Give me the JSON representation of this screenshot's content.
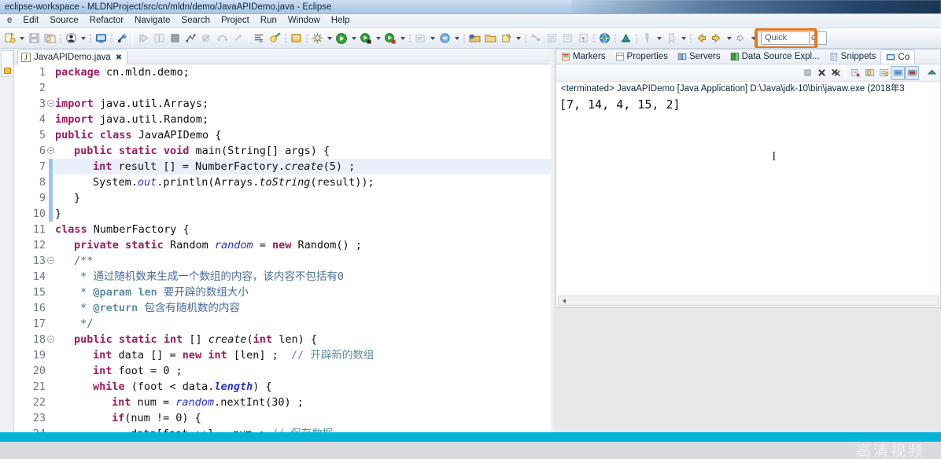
{
  "window": {
    "title": "eclipse-workspace - MLDNProject/src/cn/mldn/demo/JavaAPIDemo.java - Eclipse"
  },
  "menubar": {
    "items": [
      {
        "label": "e"
      },
      {
        "label": "Edit"
      },
      {
        "label": "Source"
      },
      {
        "label": "Refactor"
      },
      {
        "label": "Navigate"
      },
      {
        "label": "Search"
      },
      {
        "label": "Project"
      },
      {
        "label": "Run"
      },
      {
        "label": "Window"
      },
      {
        "label": "Help"
      }
    ]
  },
  "toolbar": {
    "quick_access_value": "Quick",
    "quick_access_overflow": "c",
    "highlight_color": "#e8761a",
    "icons": [
      "new-wizard-icon",
      "save-icon",
      "save-all-icon",
      "print-icon",
      "person-icon",
      "terminal-icon",
      "link-icon",
      "step-into-icon",
      "step-over-icon",
      "stop-icon",
      "relaunch-icon",
      "skip-breakpoints-icon",
      "disconnect-icon",
      "remove-terminated-icon",
      "coverage-icon",
      "task-icon",
      "note-icon",
      "build-icon",
      "run-icon",
      "debug-icon",
      "run-as-icon",
      "external-tools-icon",
      "open-type-icon",
      "search-icon",
      "open-resource-icon",
      "new-java-project-icon",
      "new-package-icon",
      "new-class-icon",
      "globe-icon",
      "profile-icon",
      "pin-icon",
      "back-icon",
      "forward-icon",
      "next-annotation-icon"
    ]
  },
  "editor": {
    "tab": {
      "label": "JavaAPIDemo.java",
      "icon": "java-file-icon",
      "close_glyph": "✖",
      "file_letter": "J"
    },
    "lines": [
      {
        "n": "1",
        "fold": false,
        "indent": 0,
        "text": "package cn.mldn.demo;"
      },
      {
        "n": "2",
        "fold": false,
        "indent": 0,
        "text": ""
      },
      {
        "n": "3",
        "fold": true,
        "indent": 0,
        "text": "import java.util.Arrays;"
      },
      {
        "n": "4",
        "fold": false,
        "indent": 0,
        "text": "import java.util.Random;"
      },
      {
        "n": "5",
        "fold": false,
        "indent": 0,
        "text": "public class JavaAPIDemo {"
      },
      {
        "n": "6",
        "fold": true,
        "indent": 1,
        "text": "public static void main(String[] args) {"
      },
      {
        "n": "7",
        "fold": false,
        "indent": 2,
        "text": "int result [] = NumberFactory.create(5) ;"
      },
      {
        "n": "8",
        "fold": false,
        "indent": 2,
        "text": "System.out.println(Arrays.toString(result));"
      },
      {
        "n": "9",
        "fold": false,
        "indent": 1,
        "text": "}"
      },
      {
        "n": "10",
        "fold": false,
        "indent": 0,
        "text": "}"
      },
      {
        "n": "11",
        "fold": false,
        "indent": 0,
        "text": "class NumberFactory {"
      },
      {
        "n": "12",
        "fold": false,
        "indent": 1,
        "text": "private static Random random = new Random() ;"
      },
      {
        "n": "13",
        "fold": true,
        "indent": 1,
        "text": "/**"
      },
      {
        "n": "14",
        "fold": false,
        "indent": 1,
        "text": " * 通过随机数来生成一个数组的内容，该内容不包括有0"
      },
      {
        "n": "15",
        "fold": false,
        "indent": 1,
        "text": " * @param len 要开辟的数组大小"
      },
      {
        "n": "16",
        "fold": false,
        "indent": 1,
        "text": " * @return 包含有随机数的内容"
      },
      {
        "n": "17",
        "fold": false,
        "indent": 1,
        "text": " */"
      },
      {
        "n": "18",
        "fold": true,
        "indent": 1,
        "text": "public static int [] create(int len) {"
      },
      {
        "n": "19",
        "fold": false,
        "indent": 2,
        "text": "int data [] = new int [len] ;  // 开辟新的数组"
      },
      {
        "n": "20",
        "fold": false,
        "indent": 2,
        "text": "int foot = 0 ;"
      },
      {
        "n": "21",
        "fold": false,
        "indent": 2,
        "text": "while (foot < data.length) {"
      },
      {
        "n": "22",
        "fold": false,
        "indent": 3,
        "text": "int num = random.nextInt(30) ;"
      },
      {
        "n": "23",
        "fold": false,
        "indent": 3,
        "text": "if(num != 0) {"
      },
      {
        "n": "24",
        "fold": false,
        "indent": 4,
        "text": "data[foot ++] = num ; // 保存数据"
      }
    ],
    "highlighted_line": "8"
  },
  "right_panel": {
    "tabs": [
      {
        "label": "Markers",
        "icon": "markers-icon",
        "active": false
      },
      {
        "label": "Properties",
        "icon": "properties-icon",
        "active": false
      },
      {
        "label": "Servers",
        "icon": "servers-icon",
        "active": false
      },
      {
        "label": "Data Source Expl...",
        "icon": "datasource-icon",
        "active": false
      },
      {
        "label": "Snippets",
        "icon": "snippets-icon",
        "active": false
      },
      {
        "label": "Co",
        "icon": "console-icon",
        "active": true
      }
    ],
    "console_toolbar_icons": [
      "terminate-icon",
      "remove-launch-icon",
      "remove-all-launches-icon",
      "clear-console-icon",
      "scroll-lock-icon",
      "word-wrap-icon",
      "show-console-icon",
      "pin-console-icon",
      "display-selected-icon"
    ],
    "console_header": "<terminated> JavaAPIDemo [Java Application] D:\\Java\\jdk-10\\bin\\javaw.exe (2018年3",
    "console_output": "[7, 14, 4, 15, 2]",
    "cursor_glyph": "I"
  },
  "overlay": {
    "bar_color": "#00b4d8",
    "watermark": "高清视频"
  }
}
